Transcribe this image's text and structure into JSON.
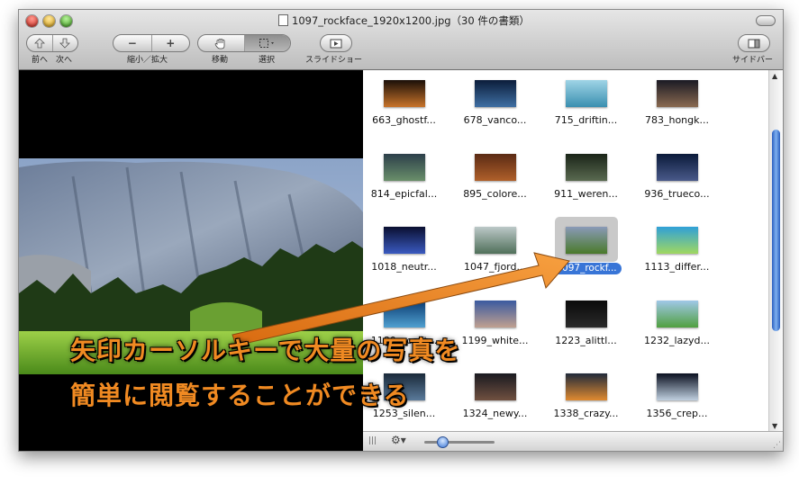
{
  "window": {
    "title": "1097_rockface_1920x1200.jpg（30 件の書類）"
  },
  "toolbar": {
    "nav_labels": "前へ　次へ",
    "zoom_label": "縮小／拡大",
    "move_label": "移動",
    "select_label": "選択",
    "slideshow_label": "スライドショー",
    "sidebar_label": "サイドバー",
    "zoom_out_glyph": "−",
    "zoom_in_glyph": "+"
  },
  "thumbnails": [
    {
      "name": "663_ghostf...",
      "colors": [
        "#1a0f08",
        "#c8742a"
      ]
    },
    {
      "name": "678_vanco...",
      "colors": [
        "#0b1d3a",
        "#3f6fa3"
      ]
    },
    {
      "name": "715_driftin...",
      "colors": [
        "#9fd4e6",
        "#3a8fb0"
      ]
    },
    {
      "name": "783_hongk...",
      "colors": [
        "#1a1a24",
        "#8a6a50"
      ]
    },
    {
      "name": "814_epicfal...",
      "colors": [
        "#2c3f4a",
        "#6a8f6a"
      ]
    },
    {
      "name": "895_colore...",
      "colors": [
        "#5a2a14",
        "#b0602a"
      ]
    },
    {
      "name": "911_weren...",
      "colors": [
        "#1a2418",
        "#5a6a50"
      ]
    },
    {
      "name": "936_trueco...",
      "colors": [
        "#0a1a3a",
        "#4a5a8a"
      ]
    },
    {
      "name": "1018_neutr...",
      "colors": [
        "#0a0f30",
        "#3a5ac0"
      ]
    },
    {
      "name": "1047_fjord...",
      "colors": [
        "#bcc8c8",
        "#50705a"
      ]
    },
    {
      "name": "1097_rockf...",
      "colors": [
        "#8a9ab8",
        "#4a7a2a"
      ],
      "selected": true
    },
    {
      "name": "1113_differ...",
      "colors": [
        "#30a0d8",
        "#a0d860"
      ]
    },
    {
      "name": "1180_coast...",
      "colors": [
        "#0a3a70",
        "#50a0d0"
      ]
    },
    {
      "name": "1199_white...",
      "colors": [
        "#3a5aa0",
        "#c0a090"
      ]
    },
    {
      "name": "1223_alittl...",
      "colors": [
        "#0a0a0a",
        "#2a2a2a"
      ]
    },
    {
      "name": "1232_lazyd...",
      "colors": [
        "#a0c8e8",
        "#50a040"
      ]
    },
    {
      "name": "1253_silen...",
      "colors": [
        "#1a2a3a",
        "#5a7a9a"
      ]
    },
    {
      "name": "1324_newy...",
      "colors": [
        "#1a1a20",
        "#705040"
      ]
    },
    {
      "name": "1338_crazy...",
      "colors": [
        "#202a3a",
        "#e08a30"
      ]
    },
    {
      "name": "1356_crep...",
      "colors": [
        "#0a1020",
        "#c0d0e0"
      ]
    }
  ],
  "bottombar": {
    "grip_glyph": "|||",
    "gear_glyph": "⚙▾",
    "thumb_size_fraction": 0.25
  },
  "caption": {
    "line1": "矢印カーソルキーで大量の写真を",
    "line2": "簡単に閲覧することができる",
    "color": "#f08a22"
  }
}
